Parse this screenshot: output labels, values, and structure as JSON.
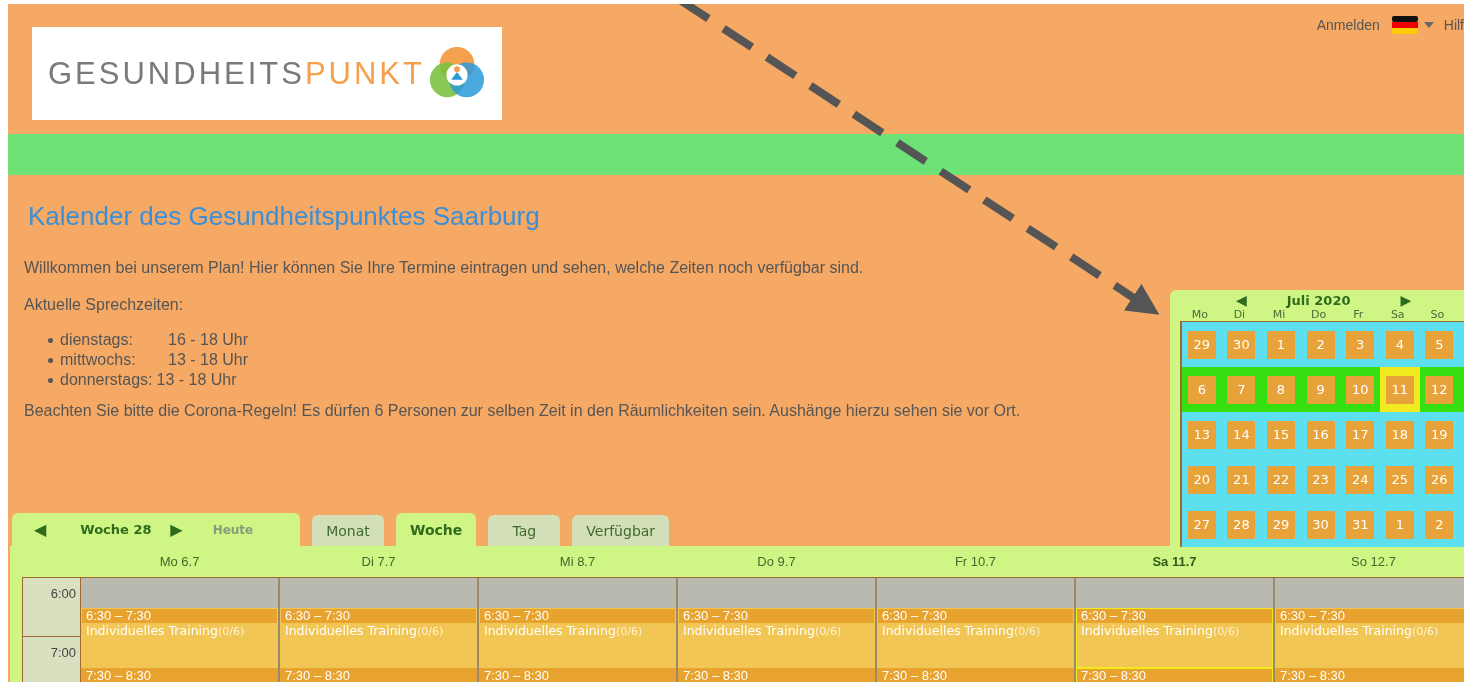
{
  "header": {
    "logo": {
      "text": "GESUNDHEITS",
      "accent": "PUNKT"
    },
    "login": "Anmelden",
    "help": "Hilf"
  },
  "title": "Kalender des Gesundheitspunktes Saarburg",
  "intro": "Willkommen bei unserem Plan! Hier können Sie Ihre Termine eintragen und sehen, welche Zeiten noch verfügbar sind.",
  "hours_label": "Aktuelle Sprechzeiten:",
  "hours": [
    {
      "day": "dienstags:",
      "time": "16 - 18 Uhr"
    },
    {
      "day": "mittwochs:",
      "time": "13 - 18 Uhr"
    },
    {
      "day": "donnerstags:",
      "time": "13 - 18 Uhr"
    }
  ],
  "notice": "Beachten Sie bitte die Corona-Regeln! Es dürfen 6 Personen zur selben Zeit in den Räumlichkeiten sein. Aushänge hierzu sehen sie vor Ort.",
  "mini_calendar": {
    "prev": "◀",
    "month": "Juli 2020",
    "next": "▶",
    "weekdays": [
      "Mo",
      "Di",
      "Mi",
      "Do",
      "Fr",
      "Sa",
      "So"
    ],
    "weeks": [
      {
        "selected": false,
        "days": [
          {
            "label": "29",
            "selected": false
          },
          {
            "label": "30",
            "selected": false
          },
          {
            "label": "1",
            "selected": false
          },
          {
            "label": "2",
            "selected": false
          },
          {
            "label": "3",
            "selected": false
          },
          {
            "label": "4",
            "selected": false
          },
          {
            "label": "5",
            "selected": false
          }
        ]
      },
      {
        "selected": true,
        "days": [
          {
            "label": "6",
            "selected": false
          },
          {
            "label": "7",
            "selected": false
          },
          {
            "label": "8",
            "selected": false
          },
          {
            "label": "9",
            "selected": false
          },
          {
            "label": "10",
            "selected": false
          },
          {
            "label": "11",
            "selected": true
          },
          {
            "label": "12",
            "selected": false
          }
        ]
      },
      {
        "selected": false,
        "days": [
          {
            "label": "13",
            "selected": false
          },
          {
            "label": "14",
            "selected": false
          },
          {
            "label": "15",
            "selected": false
          },
          {
            "label": "16",
            "selected": false
          },
          {
            "label": "17",
            "selected": false
          },
          {
            "label": "18",
            "selected": false
          },
          {
            "label": "19",
            "selected": false
          }
        ]
      },
      {
        "selected": false,
        "days": [
          {
            "label": "20",
            "selected": false
          },
          {
            "label": "21",
            "selected": false
          },
          {
            "label": "22",
            "selected": false
          },
          {
            "label": "23",
            "selected": false
          },
          {
            "label": "24",
            "selected": false
          },
          {
            "label": "25",
            "selected": false
          },
          {
            "label": "26",
            "selected": false
          }
        ]
      },
      {
        "selected": false,
        "days": [
          {
            "label": "27",
            "selected": false
          },
          {
            "label": "28",
            "selected": false
          },
          {
            "label": "29",
            "selected": false
          },
          {
            "label": "30",
            "selected": false
          },
          {
            "label": "31",
            "selected": false
          },
          {
            "label": "1",
            "selected": false
          },
          {
            "label": "2",
            "selected": false
          }
        ]
      }
    ]
  },
  "week_view": {
    "prev": "◀",
    "week": "Woche 28",
    "next": "▶",
    "today": "Heute",
    "tabs": [
      {
        "label": "Monat",
        "selected": false
      },
      {
        "label": "Woche",
        "selected": true
      },
      {
        "label": "Tag",
        "selected": false
      },
      {
        "label": "Verfügbar",
        "selected": false
      }
    ],
    "times": [
      "6:00",
      "7:00"
    ],
    "days": [
      {
        "label": "Mo 6.7",
        "selected": false,
        "events": [
          {
            "time": "6:30 – 7:30",
            "title": "Individuelles Training",
            "count": "(0/6)"
          },
          {
            "time": "7:30 – 8:30"
          }
        ]
      },
      {
        "label": "Di 7.7",
        "selected": false,
        "events": [
          {
            "time": "6:30 – 7:30",
            "title": "Individuelles Training",
            "count": "(0/6)"
          },
          {
            "time": "7:30 – 8:30"
          }
        ]
      },
      {
        "label": "Mi 8.7",
        "selected": false,
        "events": [
          {
            "time": "6:30 – 7:30",
            "title": "Individuelles Training",
            "count": "(0/6)"
          },
          {
            "time": "7:30 – 8:30"
          }
        ]
      },
      {
        "label": "Do 9.7",
        "selected": false,
        "events": [
          {
            "time": "6:30 – 7:30",
            "title": "Individuelles Training",
            "count": "(0/6)"
          },
          {
            "time": "7:30 – 8:30"
          }
        ]
      },
      {
        "label": "Fr 10.7",
        "selected": false,
        "events": [
          {
            "time": "6:30 – 7:30",
            "title": "Individuelles Training",
            "count": "(0/6)"
          },
          {
            "time": "7:30 – 8:30"
          }
        ]
      },
      {
        "label": "Sa 11.7",
        "selected": true,
        "events": [
          {
            "time": "6:30 – 7:30",
            "title": "Individuelles Training",
            "count": "(0/6)"
          },
          {
            "time": "7:30 – 8:30"
          }
        ]
      },
      {
        "label": "So 12.7",
        "selected": false,
        "events": [
          {
            "time": "6:30 – 7:30",
            "title": "Individuelles Training",
            "count": "(0/6)"
          },
          {
            "time": "7:30 – 8:30"
          }
        ]
      }
    ]
  }
}
